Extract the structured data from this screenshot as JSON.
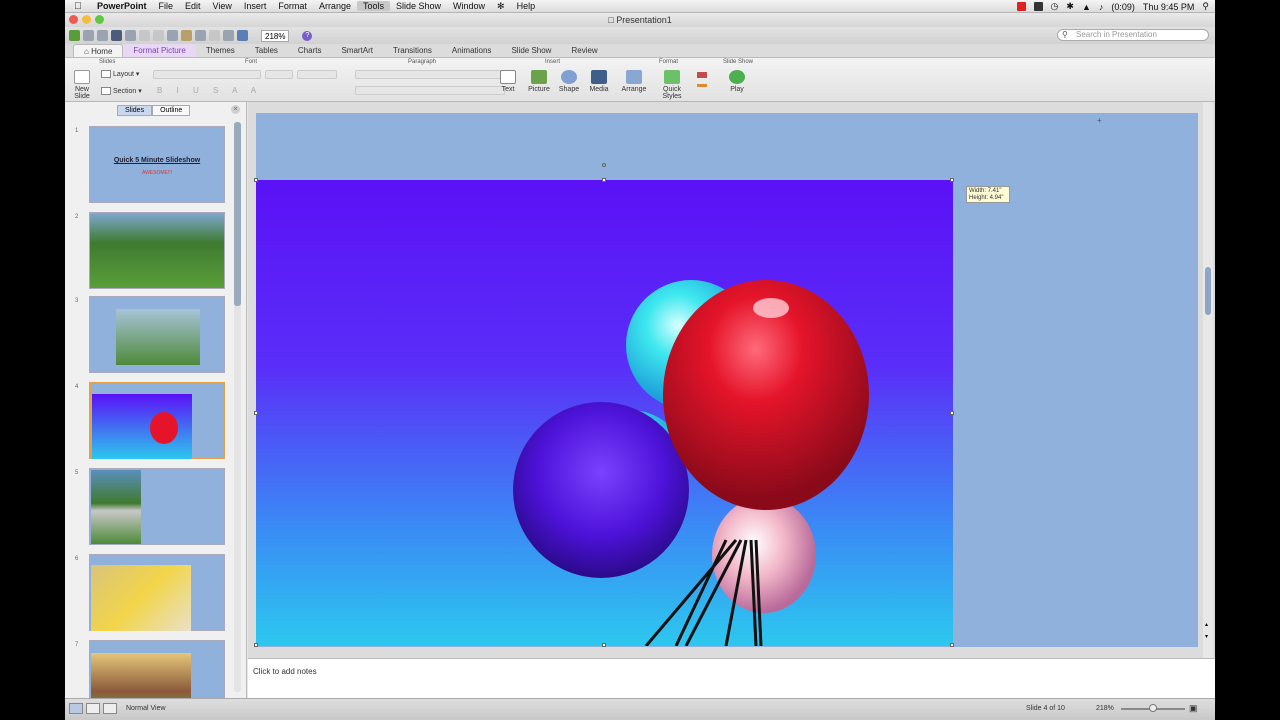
{
  "menubar": {
    "app": "PowerPoint",
    "items": [
      "File",
      "Edit",
      "View",
      "Insert",
      "Format",
      "Arrange",
      "Tools",
      "Slide Show",
      "Window",
      "Help"
    ],
    "battery": "(0:09)",
    "clock": "Thu 9:45 PM"
  },
  "window": {
    "title": "Presentation1"
  },
  "toolbar": {
    "zoom": "218%",
    "search_placeholder": "Search in Presentation"
  },
  "ribbon_tabs": [
    "Home",
    "Format Picture",
    "Themes",
    "Tables",
    "Charts",
    "SmartArt",
    "Transitions",
    "Animations",
    "Slide Show",
    "Review"
  ],
  "ribbon": {
    "groups": {
      "slides": "Slides",
      "font": "Font",
      "paragraph": "Paragraph",
      "insert": "Insert",
      "format": "Format",
      "slideshow": "Slide Show"
    },
    "new_slide": "New Slide",
    "layout": "Layout",
    "section": "Section",
    "text": "Text",
    "picture": "Picture",
    "shape": "Shape",
    "media": "Media",
    "arrange": "Arrange",
    "quick_styles": "Quick Styles",
    "play": "Play"
  },
  "pane_tabs": {
    "slides": "Slides",
    "outline": "Outline"
  },
  "thumbnails": [
    {
      "num": "1",
      "title": "Quick 5 Minute Slideshow",
      "subtitle": "AWESOME!!!"
    },
    {
      "num": "2"
    },
    {
      "num": "3"
    },
    {
      "num": "4"
    },
    {
      "num": "5"
    },
    {
      "num": "6"
    },
    {
      "num": "7"
    }
  ],
  "size_tooltip": {
    "width": "Width: 7.41\"",
    "height": "Height: 4.94\""
  },
  "notes_placeholder": "Click to add notes",
  "status": {
    "view": "Normal View",
    "slide_counter": "Slide 4 of 10",
    "zoom": "218%"
  },
  "colors": {
    "slide_bg": "#8fb1dc",
    "selection_border": "#e0a24a",
    "format_tab": "#7b3fb8"
  }
}
